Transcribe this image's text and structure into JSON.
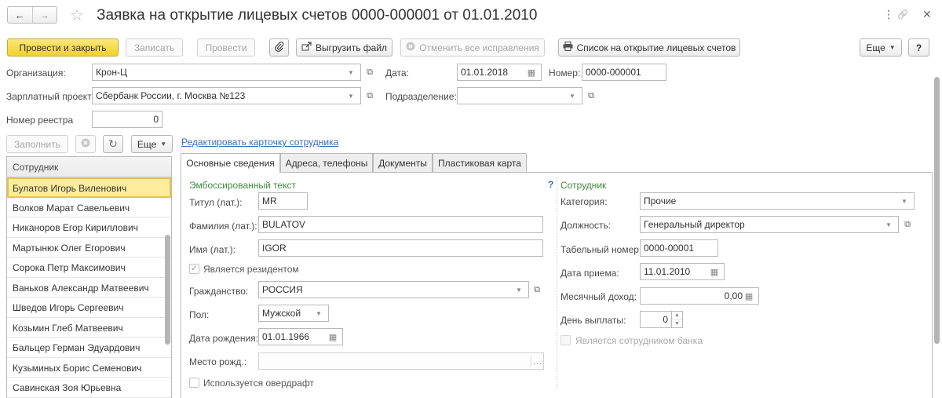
{
  "window": {
    "title": "Заявка на открытие лицевых счетов 0000-000001 от 01.01.2010",
    "nav_back": "←",
    "nav_forward": "→",
    "star": "☆",
    "menu_dots": "⋮",
    "link_glyph": "🔗",
    "close": "✕"
  },
  "toolbar": {
    "post_close": "Провести и закрыть",
    "save": "Записать",
    "post": "Провести",
    "export": "Выгрузить файл",
    "cancel_corrections": "Отменить все исправления",
    "list_open": "Список на открытие лицевых счетов",
    "more": "Еще",
    "help": "?"
  },
  "header": {
    "org_label": "Организация:",
    "org_value": "Крон-Ц",
    "date_label": "Дата:",
    "date_value": "01.01.2018",
    "number_label": "Номер:",
    "number_value": "0000-000001",
    "project_label": "Зарплатный проект:",
    "project_value": "Сбербанк России, г. Москва №123",
    "dept_label": "Подразделение:",
    "dept_value": "",
    "registry_label": "Номер реестра",
    "registry_value": "0"
  },
  "list_toolbar": {
    "fill": "Заполнить",
    "more": "Еще",
    "edit_card_link": "Редактировать карточку сотрудника"
  },
  "employees": {
    "header": "Сотрудник",
    "rows": [
      "Булатов Игорь Виленович",
      "Волков Марат Савельевич",
      "Никаноров Егор Кириллович",
      "Мартынюк Олег Егорович",
      "Сорока Петр Максимович",
      "Ваньков Александр Матвеевич",
      "Шведов Игорь Сергеевич",
      "Козьмин Глеб Матвеевич",
      "Бальцер Герман Эдуардович",
      "Кузьминых Борис Семенович",
      "Савинская Зоя Юрьевна"
    ],
    "selected_index": 0
  },
  "tabs": [
    "Основные сведения",
    "Адреса, телефоны",
    "Документы",
    "Пластиковая карта"
  ],
  "embossed": {
    "section_title": "Эмбоссированный текст",
    "help": "?",
    "title_label": "Титул (лат.):",
    "title_value": "MR",
    "lastname_label": "Фамилия (лат.):",
    "lastname_value": "BULATOV",
    "firstname_label": "Имя (лат.):",
    "firstname_value": "IGOR",
    "resident_label": "Является резидентом",
    "resident_checked": true,
    "citizenship_label": "Гражданство:",
    "citizenship_value": "РОССИЯ",
    "gender_label": "Пол:",
    "gender_value": "Мужской",
    "birthdate_label": "Дата рождения:",
    "birthdate_value": "01.01.1966",
    "birthplace_label": "Место рожд.:",
    "birthplace_value": "",
    "overdraft_label": "Используется овердрафт",
    "overdraft_checked": false
  },
  "employee_info": {
    "section_title": "Сотрудник",
    "category_label": "Категория:",
    "category_value": "Прочие",
    "position_label": "Должность:",
    "position_value": "Генеральный директор",
    "tab_number_label": "Табельный номер:",
    "tab_number_value": "0000-00001",
    "hire_date_label": "Дата приема:",
    "hire_date_value": "11.01.2010",
    "income_label": "Месячный доход:",
    "income_value": "0,00",
    "payday_label": "День выплаты:",
    "payday_value": "0",
    "bank_employee_label": "Является сотрудником банка",
    "bank_employee_checked": false
  },
  "colors": {
    "primary_button": "#f2d12a",
    "selected_row": "#fdec9c",
    "link": "#3a6cb3",
    "section_title": "#3f8a3f"
  }
}
